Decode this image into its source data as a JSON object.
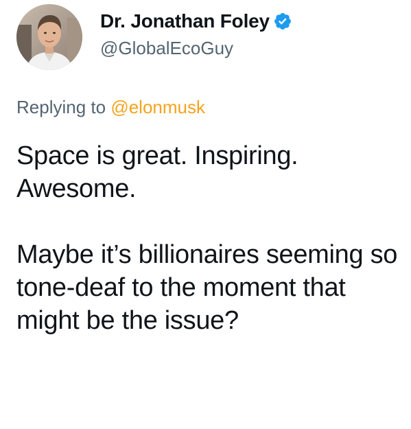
{
  "tweet": {
    "author": {
      "display_name": "Dr. Jonathan Foley",
      "handle": "@GlobalEcoGuy",
      "verified": true,
      "avatar_icon": "profile-photo"
    },
    "reply": {
      "prefix": "Replying to",
      "mention": "@elonmusk"
    },
    "paragraphs": [
      "Space is great. Inspiring. Awesome.",
      "Maybe it’s billionaires seeming so tone-deaf to the moment that might be the issue?"
    ]
  },
  "colors": {
    "text": "#0f1419",
    "secondary_text": "#536471",
    "mention": "#f4a31c",
    "verified_badge": "#1d9bf0"
  }
}
